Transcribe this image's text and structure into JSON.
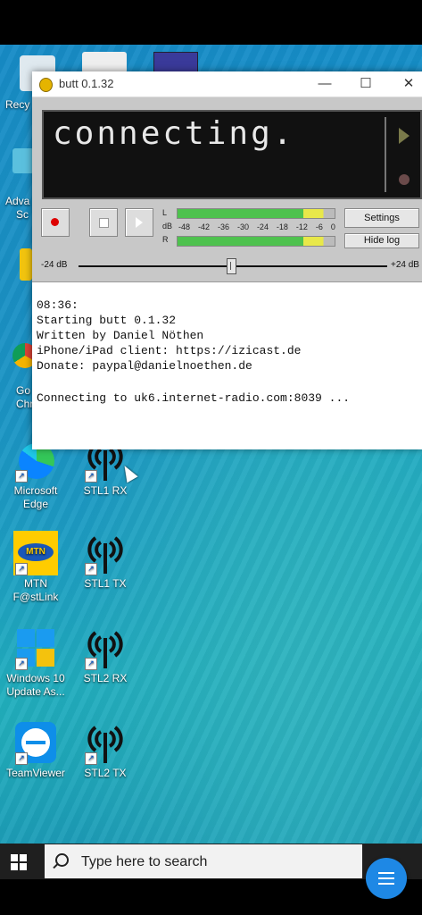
{
  "window": {
    "title": "butt 0.1.32",
    "minimize_glyph": "—",
    "maximize_glyph": "☐",
    "close_glyph": "✕"
  },
  "display": {
    "status_text": "connecting."
  },
  "controls": {
    "record_icon": "record-icon",
    "stop_icon": "stop-icon",
    "play_icon": "play-icon",
    "settings_label": "Settings",
    "hide_log_label": "Hide log"
  },
  "vu_meter": {
    "left_label": "L",
    "db_label": "dB",
    "right_label": "R",
    "scale": [
      "-48",
      "-42",
      "-36",
      "-30",
      "-24",
      "-18",
      "-12",
      "-6",
      "0"
    ]
  },
  "gain": {
    "min_label": "-24 dB",
    "max_label": "+24 dB",
    "value_db": 0
  },
  "log": {
    "lines": [
      "08:36:",
      "Starting butt 0.1.32",
      "Written by Daniel Nöthen",
      "iPhone/iPad client: https://izicast.de",
      "Donate: paypal@danielnoethen.de",
      "",
      "Connecting to uk6.internet-radio.com:8039 ..."
    ]
  },
  "desktop": {
    "partial_labels": {
      "recycle": "Recy",
      "adva": "Adva",
      "sc": "Sc",
      "go": "Go",
      "chr": "Chr"
    },
    "icons": [
      {
        "label": "Microsoft\nEdge"
      },
      {
        "label": "STL1 RX"
      },
      {
        "label": "MTN\nF@stLink"
      },
      {
        "label": "STL1 TX"
      },
      {
        "label": "Windows 10\nUpdate As..."
      },
      {
        "label": "STL2 RX"
      },
      {
        "label": "TeamViewer"
      },
      {
        "label": "STL2 TX"
      }
    ]
  },
  "taskbar": {
    "search_placeholder": "Type here to search"
  },
  "colors": {
    "accent": "#1e88e5",
    "vu_green": "#4ec24e",
    "vu_yellow": "#e8e84a"
  }
}
